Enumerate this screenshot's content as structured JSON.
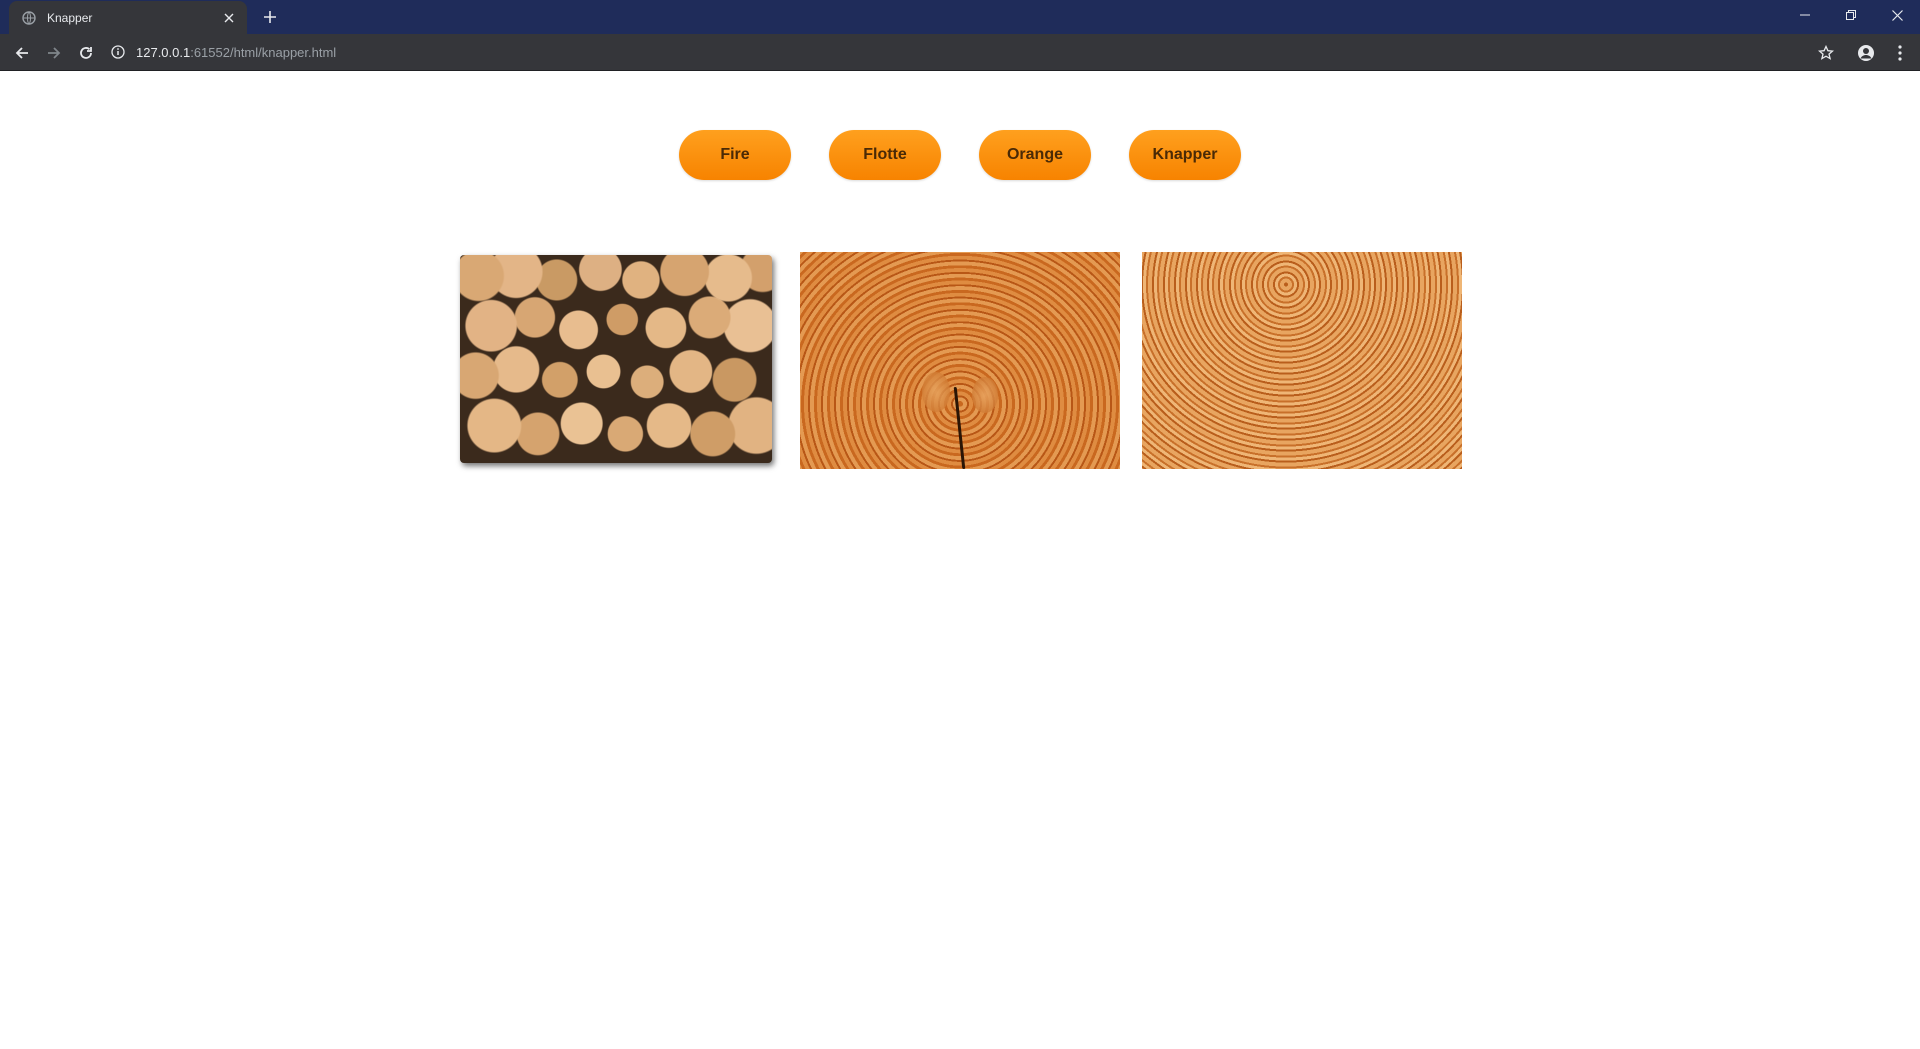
{
  "browser": {
    "tab_title": "Knapper",
    "url_host": "127.0.0.1",
    "url_path": ":61552/html/knapper.html"
  },
  "menu": {
    "buttons": [
      "Fire",
      "Flotte",
      "Orange",
      "Knapper"
    ]
  },
  "colors": {
    "button_top": "#ffa01e",
    "button_bottom": "#f78300",
    "titlebar": "#1f2c5a",
    "toolbar": "#35363a"
  },
  "gallery": {
    "images": [
      "firewood-pile",
      "tree-rings-cracked",
      "tree-rings"
    ]
  }
}
